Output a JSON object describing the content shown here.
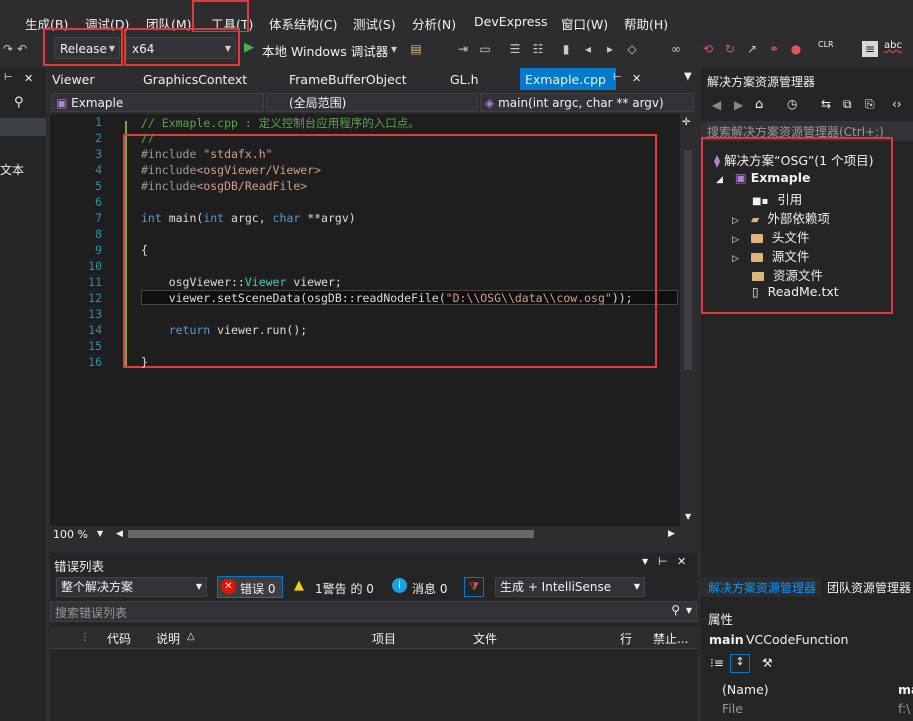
{
  "menu": [
    "生成(B)",
    "调试(D)",
    "团队(M)",
    "工具(T)",
    "体系结构(C)",
    "测试(S)",
    "分析(N)",
    "DevExpress",
    "窗口(W)",
    "帮助(H)"
  ],
  "toolbar": {
    "config": "Release",
    "platform": "x64",
    "run_label": "本地 Windows 调试器"
  },
  "left_strip": {
    "text": "文本"
  },
  "tabs": [
    "Viewer",
    "GraphicsContext",
    "FrameBufferObject",
    "GL.h",
    "Exmaple.cpp"
  ],
  "nav": {
    "project": "Exmaple",
    "scope": "(全局范围)",
    "function": "main(int argc, char ** argv)"
  },
  "zoom": "100 %",
  "code_lines": [
    {
      "n": "1",
      "parts": [
        {
          "c": "cm",
          "t": "// Exmaple.cpp : 定义控制台应用程序的入口点。"
        }
      ]
    },
    {
      "n": "2",
      "parts": [
        {
          "c": "cm",
          "t": "//"
        }
      ]
    },
    {
      "n": "3",
      "parts": [
        {
          "c": "pp",
          "t": "#include "
        },
        {
          "c": "str",
          "t": "\"stdafx.h\""
        }
      ]
    },
    {
      "n": "4",
      "parts": [
        {
          "c": "pp",
          "t": "#include"
        },
        {
          "c": "str",
          "t": "<osgViewer/Viewer>"
        }
      ]
    },
    {
      "n": "5",
      "parts": [
        {
          "c": "pp",
          "t": "#include"
        },
        {
          "c": "str",
          "t": "<osgDB/ReadFile>"
        }
      ]
    },
    {
      "n": "6",
      "parts": []
    },
    {
      "n": "7",
      "parts": [
        {
          "c": "kw",
          "t": "int"
        },
        {
          "c": "",
          "t": " main("
        },
        {
          "c": "kw",
          "t": "int"
        },
        {
          "c": "",
          "t": " argc, "
        },
        {
          "c": "kw",
          "t": "char"
        },
        {
          "c": "",
          "t": " **argv)"
        }
      ]
    },
    {
      "n": "8",
      "parts": []
    },
    {
      "n": "9",
      "parts": [
        {
          "c": "",
          "t": "{"
        }
      ]
    },
    {
      "n": "10",
      "parts": []
    },
    {
      "n": "11",
      "parts": [
        {
          "c": "",
          "t": "    osgViewer::"
        },
        {
          "c": "ty",
          "t": "Viewer"
        },
        {
          "c": "",
          "t": " viewer;"
        }
      ]
    },
    {
      "n": "12",
      "parts": [
        {
          "c": "",
          "t": "    viewer.setSceneData(osgDB::readNodeFile("
        },
        {
          "c": "str",
          "t": "\"D:\\\\OSG\\\\data\\\\cow.osg\""
        },
        {
          "c": "",
          "t": "));"
        }
      ]
    },
    {
      "n": "13",
      "parts": []
    },
    {
      "n": "14",
      "parts": [
        {
          "c": "kw",
          "t": "    return"
        },
        {
          "c": "",
          "t": " viewer.run();"
        }
      ]
    },
    {
      "n": "15",
      "parts": []
    },
    {
      "n": "16",
      "parts": [
        {
          "c": "",
          "t": "}"
        }
      ]
    }
  ],
  "error_panel": {
    "title": "错误列表",
    "scope": "整个解决方案",
    "errors": "错误 0",
    "warnings": "1警告 的 0",
    "messages": "消息 0",
    "source": "生成 + IntelliSense",
    "search_placeholder": "搜索错误列表",
    "columns": [
      "代码",
      "说明",
      "项目",
      "文件",
      "行",
      "禁止..."
    ]
  },
  "solution_explorer": {
    "title": "解决方案资源管理器",
    "search_placeholder": "搜索解决方案资源管理器(Ctrl+;)",
    "solution": "解决方案“OSG”(1 个项目)",
    "project": "Exmaple",
    "items": [
      "引用",
      "外部依赖项",
      "头文件",
      "源文件",
      "资源文件",
      "ReadMe.txt"
    ],
    "bottom_tabs": [
      "解决方案资源管理器",
      "团队资源管理器"
    ]
  },
  "properties": {
    "title": "属性",
    "object": "main",
    "object_type": "VCCodeFunction",
    "rows": [
      {
        "name": "(Name)",
        "value": "ma"
      },
      {
        "name": "File",
        "value": "f:\\"
      }
    ]
  },
  "colors": {
    "accent": "#007acc",
    "highlight_box": "#e03a3a",
    "background": "#2d2d30",
    "editor_bg": "#1e1e1e"
  }
}
